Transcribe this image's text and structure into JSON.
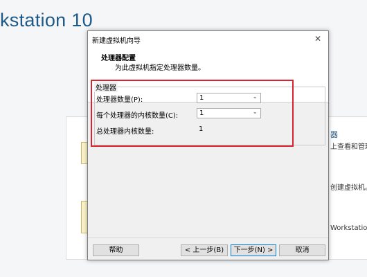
{
  "background": {
    "app_title": "kstation 10",
    "side_heading": "器",
    "side_text_1": "上查看和管理",
    "side_text_2": "创建虚拟机。",
    "side_text_3": "Workstation"
  },
  "dialog": {
    "title": "新建虚拟机向导",
    "close_glyph": "✕",
    "header_title": "处理器配置",
    "header_desc": "为此虚拟机指定处理器数量。",
    "group_label": "处理器",
    "processors_label": "处理器数量(P):",
    "processors_value": "1",
    "cores_label": "每个处理器的内核数量(C):",
    "cores_value": "1",
    "total_label": "总处理器内核数量:",
    "total_value": "1",
    "buttons": {
      "help": "帮助",
      "back": "< 上一步(B)",
      "next": "下一步(N) >",
      "cancel": "取消"
    }
  },
  "colors": {
    "highlight": "#d9232e",
    "title_blue": "#1f5a86"
  }
}
